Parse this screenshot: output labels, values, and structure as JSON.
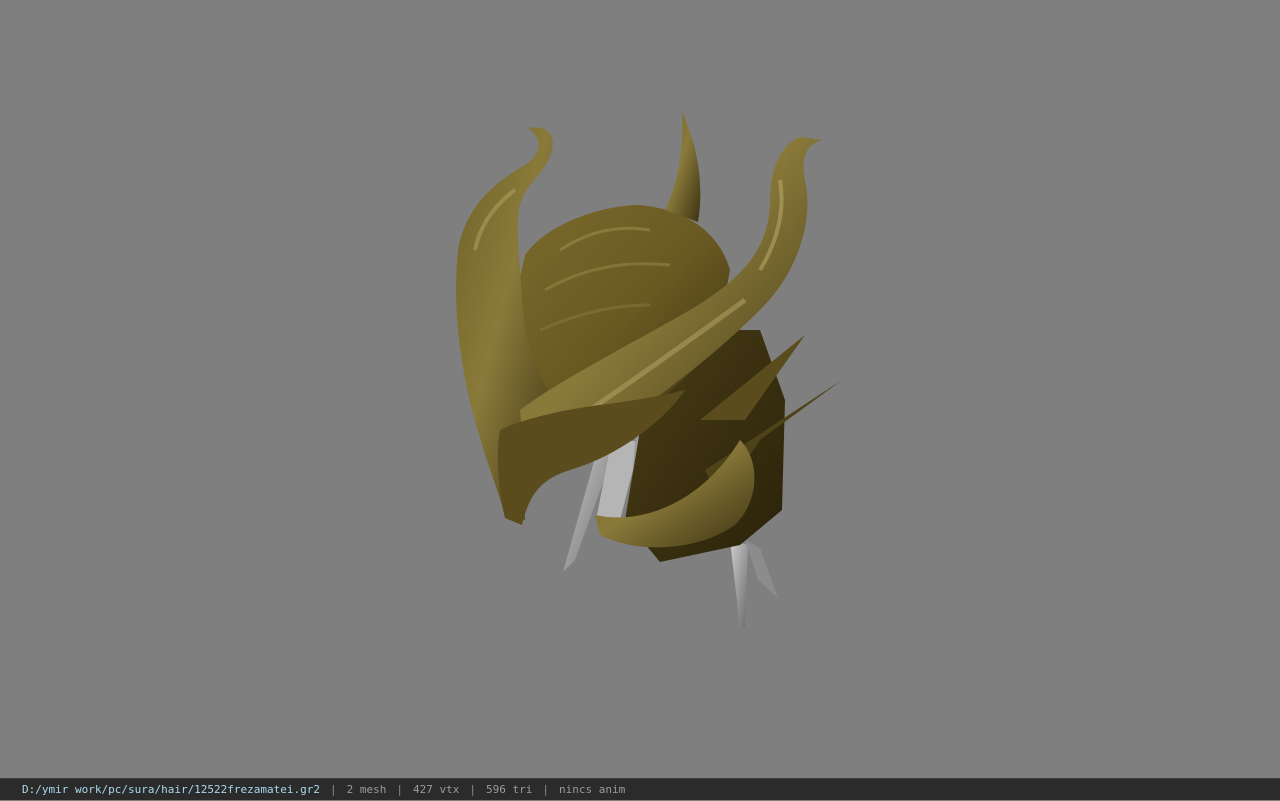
{
  "viewer": {
    "background_color": "#7f7f7f",
    "model_name": "helmet-with-horns"
  },
  "status_bar": {
    "file_path": "D:/ymir work/pc/sura/hair/12522frezamatei.gr2",
    "separator": "|",
    "mesh_count": "2 mesh",
    "vertex_count": "427 vtx",
    "triangle_count": "596 tri",
    "animation_status": "nincs anim",
    "path_color": "#a8d8ea",
    "text_color": "#9a9a9a",
    "background_color": "#2b2b2b"
  }
}
